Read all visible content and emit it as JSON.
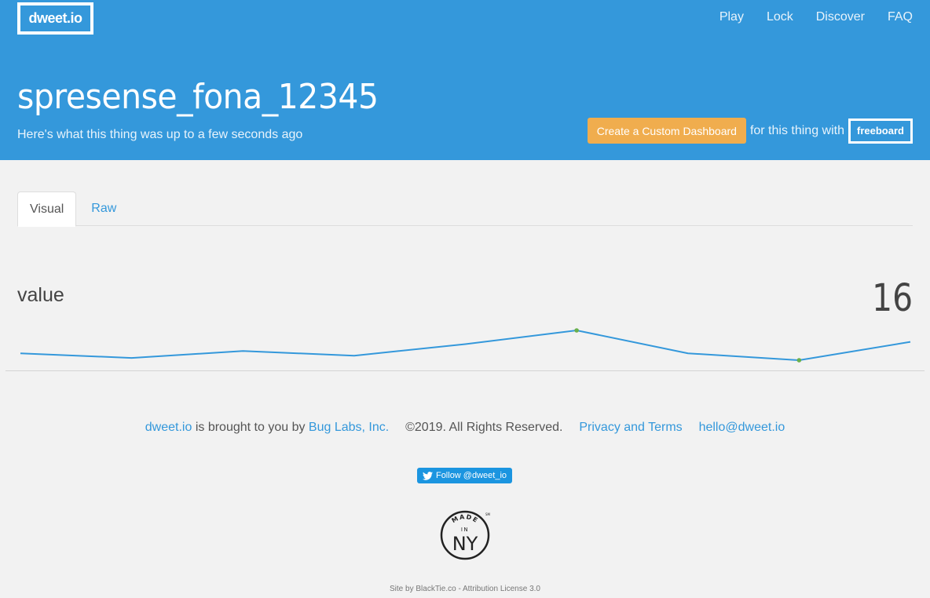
{
  "header": {
    "brand": "dweet.io",
    "nav": [
      {
        "label": "Play"
      },
      {
        "label": "Lock"
      },
      {
        "label": "Discover"
      },
      {
        "label": "FAQ"
      }
    ],
    "thing_name": "spresense_fona_12345",
    "subtitle": "Here's what this thing was up to a few seconds ago",
    "dashboard_button": "Create a Custom Dashboard",
    "for_text": "for this thing with",
    "freeboard_button": "freeboard"
  },
  "tabs": [
    {
      "label": "Visual",
      "active": true
    },
    {
      "label": "Raw",
      "active": false
    }
  ],
  "widget": {
    "label": "value",
    "current_value": "16",
    "line_color": "#3498db",
    "marker_color": "#6ab04c"
  },
  "chart_data": {
    "type": "line",
    "title": "value",
    "x": [
      1,
      2,
      3,
      4,
      5,
      6,
      7,
      8,
      9
    ],
    "values": [
      11,
      9,
      12,
      10,
      15,
      21,
      11,
      8,
      16
    ],
    "highlight": {
      "max_index": 5,
      "min_index": 7
    },
    "xlabel": "",
    "ylabel": "",
    "grid": false,
    "legend": "none"
  },
  "footer": {
    "brand_link": "dweet.io",
    "brought_text": " is brought to you by ",
    "company_link": "Bug Labs, Inc.",
    "copyright": "©2019. All Rights Reserved.",
    "privacy_link": "Privacy and Terms",
    "email_link": "hello@dweet.io",
    "twitter_button": "Follow @dweet_io",
    "badge_top": "MADE",
    "badge_mid": "IN",
    "badge_main": "NY",
    "badge_sm": "SM",
    "site_by": "Site by BlackTie.co - Attribution License 3.0"
  },
  "colors": {
    "header_bg": "#3498db",
    "page_bg": "#f2f2f2",
    "accent_button": "#f0ad4e",
    "link": "#3498db",
    "twitter": "#1b95e0"
  }
}
